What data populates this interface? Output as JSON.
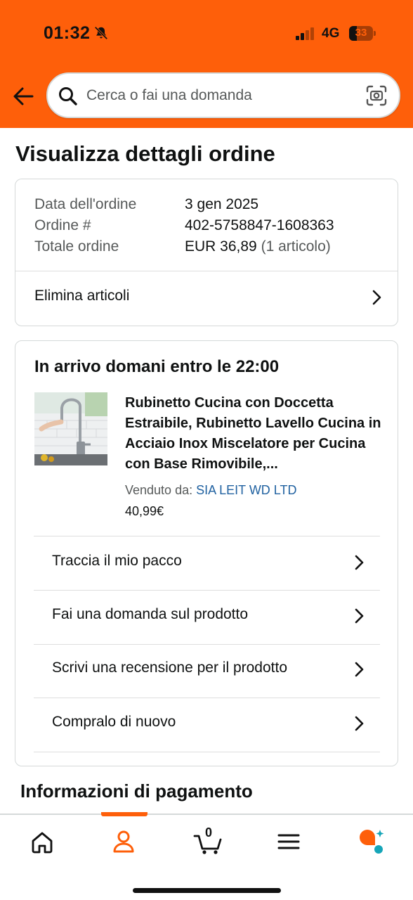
{
  "status_bar": {
    "time": "01:32",
    "network": "4G",
    "battery": "33",
    "battery_level": 0.33,
    "icons": [
      "bell-slash-icon",
      "signal-icon",
      "battery-icon"
    ]
  },
  "header": {
    "search_placeholder": "Cerca o fai una domanda",
    "icons": [
      "back-arrow-icon",
      "search-icon",
      "camera-scan-icon"
    ]
  },
  "page_title": "Visualizza dettagli ordine",
  "order_summary": {
    "date_label": "Data dell'ordine",
    "date_value": "3 gen 2025",
    "number_label": "Ordine #",
    "number_value": "402-5758847-1608363",
    "total_label": "Totale ordine",
    "total_value": "EUR 36,89",
    "total_items": "(1 articolo)",
    "delete_items_label": "Elimina articoli"
  },
  "shipment": {
    "arrival": "In arrivo domani entro le 22:00",
    "product": {
      "title": "Rubinetto Cucina con Doccetta Estraibile, Rubinetto Lavello Cucina in Acciaio Inox Miscelatore per Cucina con Base Rimovibile,...",
      "sold_by_label": "Venduto da:",
      "seller": "SIA LEIT WD LTD",
      "price": "40,99€"
    },
    "actions": [
      {
        "label": "Traccia il mio pacco"
      },
      {
        "label": "Fai una domanda sul prodotto"
      },
      {
        "label": "Scrivi una recensione per il prodotto"
      },
      {
        "label": "Compralo di nuovo"
      }
    ]
  },
  "payment_title": "Informazioni di pagamento",
  "tab_bar": {
    "cart_count": "0",
    "active_tab": "account",
    "accent_color": "#fe5f0a",
    "tabs": [
      "home-icon",
      "account-icon",
      "cart-icon",
      "menu-icon",
      "assistant-icon"
    ]
  },
  "colors": {
    "header_bg": "#fe5f0a",
    "link": "#2162a1",
    "text": "#0f1111",
    "muted": "#565959"
  }
}
